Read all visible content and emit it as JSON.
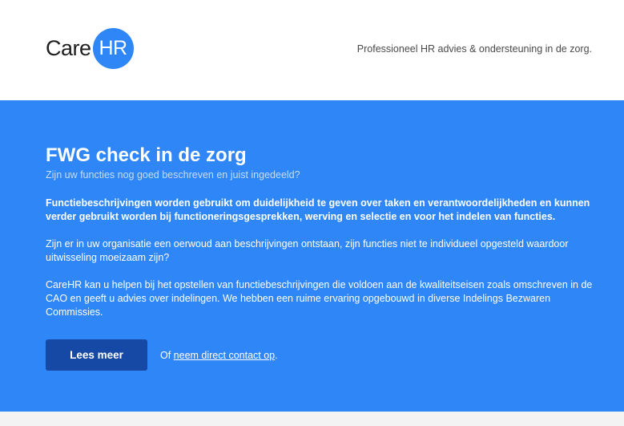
{
  "header": {
    "logo_text": "Care",
    "logo_badge": "HR",
    "tagline": "Professioneel HR advies & ondersteuning in de zorg."
  },
  "hero": {
    "title": "FWG check in de zorg",
    "subtitle": "Zijn uw functies nog goed beschreven en juist ingedeeld?",
    "intro_bold": "Functiebeschrijvingen worden gebruikt om duidelijkheid te geven over taken en verantwoordelijkheden en kunnen verder gebruikt worden bij functioneringsgesprekken, werving en selectie en voor het indelen van functies.",
    "paragraph_1": "Zijn er in uw organisatie een oerwoud aan beschrijvingen ontstaan, zijn functies niet te individueel opgesteld waardoor uitwisseling moeizaam zijn?",
    "paragraph_2": "CareHR kan u helpen bij het opstellen van functiebeschrijvingen die voldoen aan de kwaliteitseisen zoals omschreven in de CAO en geeft u advies over indelingen. We hebben een ruime ervaring opgebouwd in diverse Indelings Bezwaren Commissies.",
    "button_label": "Lees meer",
    "contact_prefix": "Of ",
    "contact_link": "neem direct contact op",
    "contact_suffix": "."
  },
  "colors": {
    "brand_blue": "#2f86f6",
    "button_blue": "#1648a5",
    "subtitle": "#c6ddfb"
  }
}
